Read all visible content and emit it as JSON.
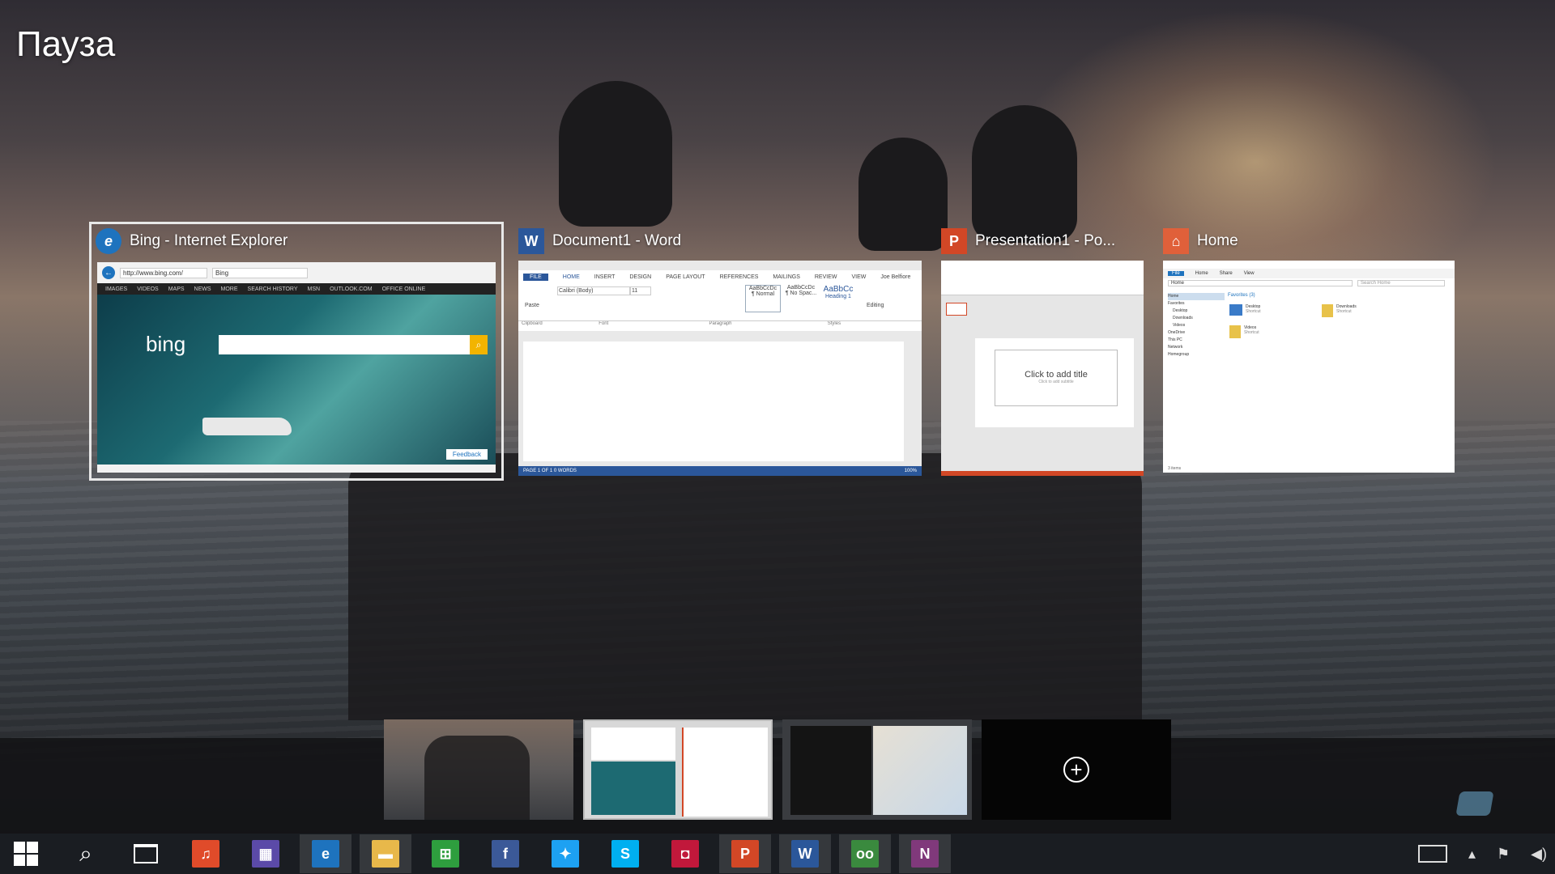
{
  "screen_label": "Пауза",
  "windows": [
    {
      "title": "Bing - Internet Explorer",
      "badge": "e",
      "badge_color": "#1e73be",
      "url": "http://www.bing.com/",
      "tab": "Bing",
      "nav": [
        "IMAGES",
        "VIDEOS",
        "MAPS",
        "NEWS",
        "MORE",
        "SEARCH HISTORY",
        "MSN",
        "OUTLOOK.COM",
        "OFFICE ONLINE"
      ],
      "logo": "bing",
      "feedback": "Feedback"
    },
    {
      "title": "Document1 - Word",
      "badge": "W",
      "badge_color": "#2b579a",
      "ribbon_tabs": [
        "FILE",
        "HOME",
        "INSERT",
        "DESIGN",
        "PAGE LAYOUT",
        "REFERENCES",
        "MAILINGS",
        "REVIEW",
        "VIEW"
      ],
      "user": "Joe Belfiore",
      "font": "Calibri (Body)",
      "font_size": "11",
      "styles": [
        {
          "preview": "AaBbCcDc",
          "name": "¶ Normal"
        },
        {
          "preview": "AaBbCcDc",
          "name": "¶ No Spac..."
        },
        {
          "preview": "AaBbCc",
          "name": "Heading 1"
        }
      ],
      "groups": [
        "Clipboard",
        "Font",
        "Paragraph",
        "Styles"
      ],
      "editing": "Editing",
      "paste": "Paste",
      "status": "PAGE 1 OF 1    0 WORDS",
      "zoom": "100%"
    },
    {
      "title": "Presentation1 - Po...",
      "badge": "P",
      "badge_color": "#d24726",
      "slide_title": "Click to add title",
      "slide_subtitle": "Click to add subtitle"
    },
    {
      "title": "Home",
      "badge": "⌂",
      "badge_color": "#e0603a",
      "tabs": [
        "File",
        "Home",
        "Share",
        "View"
      ],
      "address": "Home",
      "search": "Search Home",
      "tree": [
        "Home",
        "Favorites",
        "Desktop",
        "Downloads",
        "Videos",
        "OneDrive",
        "This PC",
        "Network",
        "Homegroup"
      ],
      "section": "Favorites (3)",
      "items": [
        {
          "name": "Desktop",
          "sub": "Shortcut"
        },
        {
          "name": "Downloads",
          "sub": "Shortcut"
        },
        {
          "name": "Videos",
          "sub": "Shortcut"
        }
      ],
      "status": "3 items"
    }
  ],
  "desktops_add": "+",
  "taskbar": {
    "apps": [
      {
        "name": "music",
        "label": "♫",
        "color": "#e04b2a"
      },
      {
        "name": "calculator",
        "label": "▦",
        "color": "#5b4aa8"
      },
      {
        "name": "internet-explorer",
        "label": "e",
        "color": "#1e73be"
      },
      {
        "name": "file-explorer",
        "label": "▬",
        "color": "#e8b84a"
      },
      {
        "name": "store",
        "label": "⊞",
        "color": "#2e9e3e"
      },
      {
        "name": "facebook",
        "label": "f",
        "color": "#3b5998"
      },
      {
        "name": "twitter",
        "label": "✦",
        "color": "#1da1f2"
      },
      {
        "name": "skype",
        "label": "S",
        "color": "#00aff0"
      },
      {
        "name": "photo",
        "label": "◘",
        "color": "#c1183b"
      },
      {
        "name": "powerpoint",
        "label": "P",
        "color": "#d24726"
      },
      {
        "name": "word",
        "label": "W",
        "color": "#2b579a"
      },
      {
        "name": "tripadvisor",
        "label": "oo",
        "color": "#3a8a3e"
      },
      {
        "name": "onenote",
        "label": "N",
        "color": "#80397b"
      }
    ]
  }
}
